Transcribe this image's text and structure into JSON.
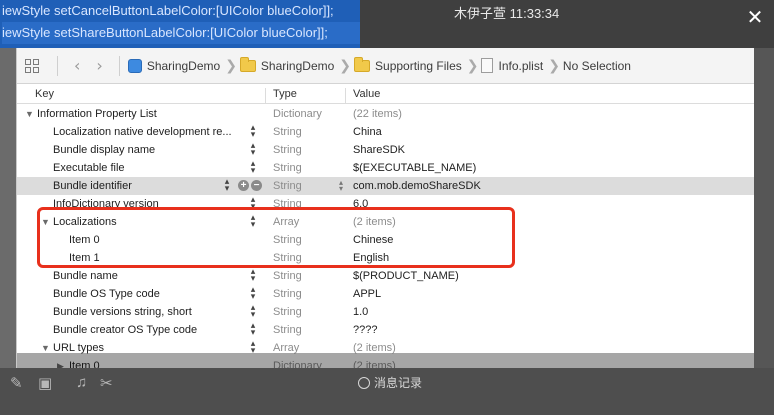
{
  "background": {
    "code_lines": [
      "iewStyle setCancelButtonLabelColor:[UIColor blueColor]];",
      "iewStyle setShareButtonLabelColor:[UIColor blueColor]];"
    ],
    "chat_title": "木伊子萱 11:33:34",
    "history_label": "消息记录"
  },
  "jump_bar": {
    "crumbs": [
      "SharingDemo",
      "SharingDemo",
      "Supporting Files",
      "Info.plist",
      "No Selection"
    ]
  },
  "columns": {
    "key": "Key",
    "type": "Type",
    "value": "Value"
  },
  "rows": [
    {
      "key": "Information Property List",
      "type": "Dictionary",
      "value": "(22 items)",
      "expanded": true
    },
    {
      "key": "Localization native development re...",
      "type": "String",
      "value": "China"
    },
    {
      "key": "Bundle display name",
      "type": "String",
      "value": "ShareSDK"
    },
    {
      "key": "Executable file",
      "type": "String",
      "value": "$(EXECUTABLE_NAME)"
    },
    {
      "key": "Bundle identifier",
      "type": "String",
      "value": "com.mob.demoShareSDK",
      "selected": true
    },
    {
      "key": "InfoDictionary version",
      "type": "String",
      "value": "6.0"
    },
    {
      "key": "Localizations",
      "type": "Array",
      "value": "(2 items)",
      "expanded": true
    },
    {
      "key": "Item 0",
      "type": "String",
      "value": "Chinese"
    },
    {
      "key": "Item 1",
      "type": "String",
      "value": "English"
    },
    {
      "key": "Bundle name",
      "type": "String",
      "value": "$(PRODUCT_NAME)"
    },
    {
      "key": "Bundle OS Type code",
      "type": "String",
      "value": "APPL"
    },
    {
      "key": "Bundle versions string, short",
      "type": "String",
      "value": "1.0"
    },
    {
      "key": "Bundle creator OS Type code",
      "type": "String",
      "value": "????"
    },
    {
      "key": "URL types",
      "type": "Array",
      "value": "(2 items)",
      "expanded": true
    },
    {
      "key": "Item 0",
      "type": "Dictionary",
      "value": "(2 items)",
      "expanded": false
    }
  ],
  "highlight_color": "#e8301c"
}
